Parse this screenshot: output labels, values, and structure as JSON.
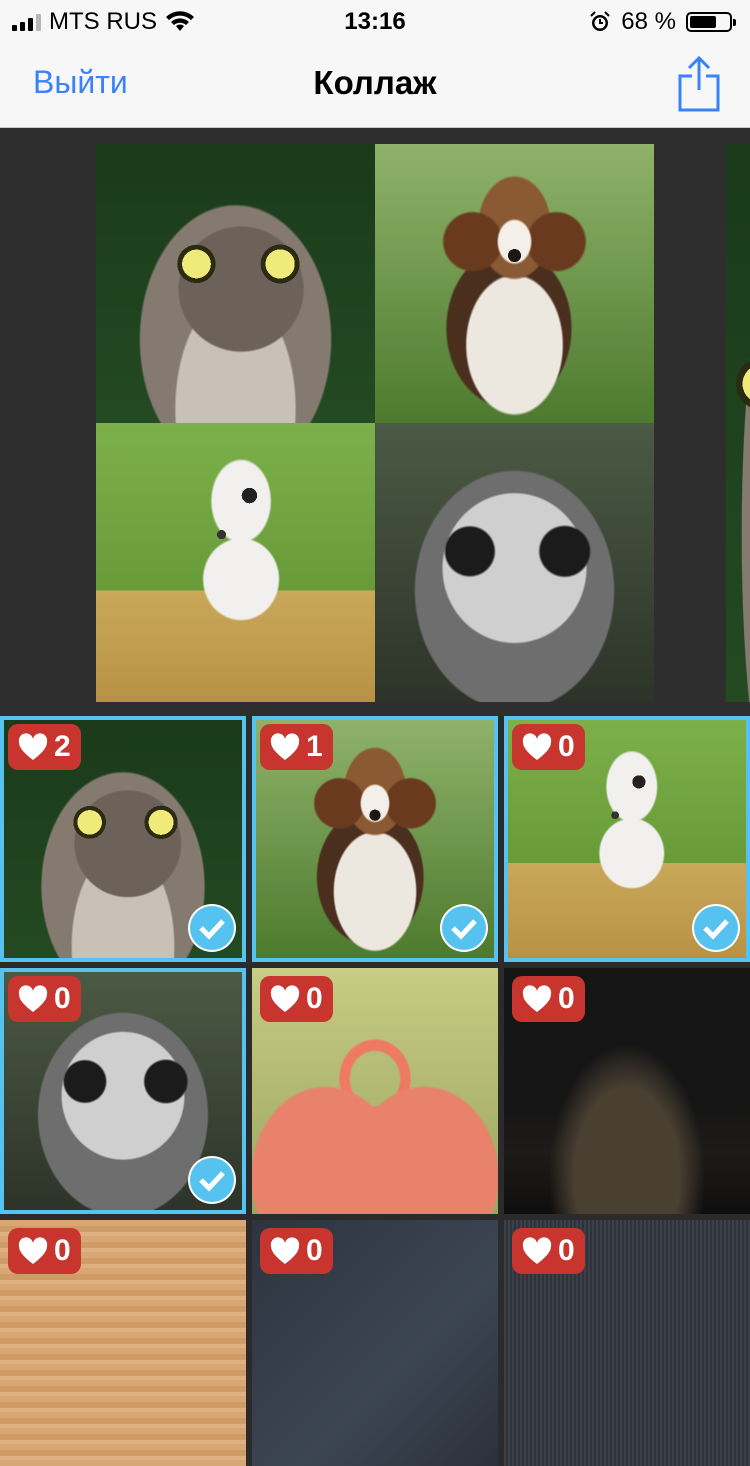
{
  "status_bar": {
    "carrier": "MTS RUS",
    "time": "13:16",
    "battery_percent": "68 %",
    "battery_level": 0.68,
    "icons": [
      "signal-icon",
      "wifi-icon",
      "alarm-icon",
      "battery-icon"
    ]
  },
  "nav": {
    "back_label": "Выйти",
    "title": "Коллаж",
    "share_icon": "share-icon"
  },
  "colors": {
    "accent_blue": "#3a82f7",
    "selection": "#55c2f0",
    "badge_red": "#c8342e"
  },
  "collage": {
    "cells": [
      "owl",
      "beagle",
      "dalmatian",
      "barn-owl"
    ]
  },
  "photos": [
    {
      "subject": "owl",
      "likes": "2",
      "selected": true
    },
    {
      "subject": "beagle",
      "likes": "1",
      "selected": true
    },
    {
      "subject": "dalmatian",
      "likes": "0",
      "selected": true
    },
    {
      "subject": "barn-owl",
      "likes": "0",
      "selected": true
    },
    {
      "subject": "flamingos",
      "likes": "0",
      "selected": false
    },
    {
      "subject": "night-landscape",
      "likes": "0",
      "selected": false
    },
    {
      "subject": "wood",
      "likes": "0",
      "selected": false
    },
    {
      "subject": "denim",
      "likes": "0",
      "selected": false
    },
    {
      "subject": "static",
      "likes": "0",
      "selected": false
    }
  ]
}
